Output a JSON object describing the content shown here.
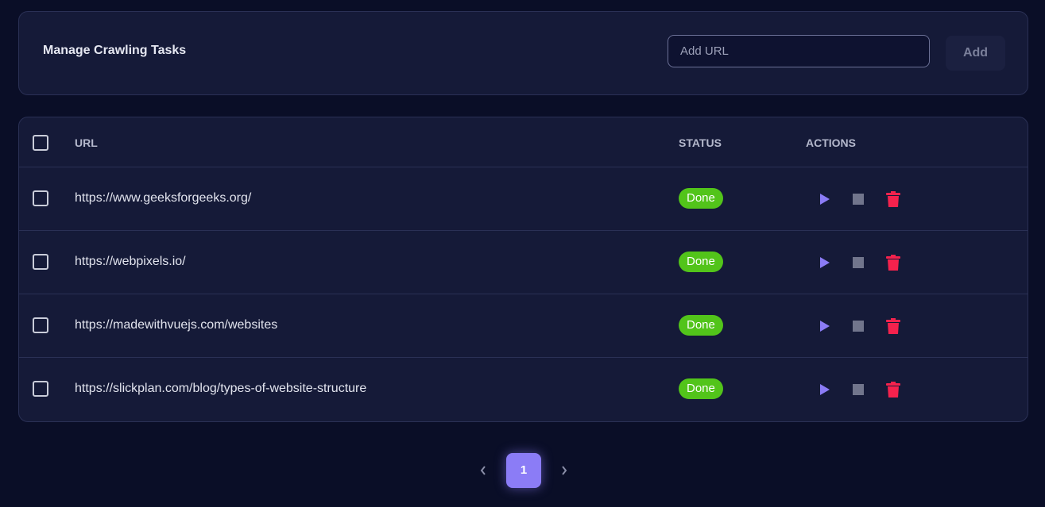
{
  "header": {
    "title": "Manage Crawling Tasks",
    "url_placeholder": "Add URL",
    "url_value": "",
    "add_label": "Add"
  },
  "table": {
    "columns": {
      "url": "URL",
      "status": "STATUS",
      "actions": "ACTIONS"
    },
    "rows": [
      {
        "url": "https://www.geeksforgeeks.org/",
        "status": "Done"
      },
      {
        "url": "https://webpixels.io/",
        "status": "Done"
      },
      {
        "url": "https://madewithvuejs.com/websites",
        "status": "Done"
      },
      {
        "url": "https://slickplan.com/blog/types-of-website-structure",
        "status": "Done"
      }
    ]
  },
  "pagination": {
    "current_page": "1"
  },
  "icons": {
    "play": "play-icon",
    "stop": "stop-icon",
    "delete": "trash-icon",
    "prev": "chevron-left-icon",
    "next": "chevron-right-icon"
  },
  "colors": {
    "background": "#0a0e27",
    "card": "#151a38",
    "accent": "#8b7cf6",
    "status_done": "#52c41a",
    "delete": "#f5224d",
    "stop": "#71758c"
  }
}
